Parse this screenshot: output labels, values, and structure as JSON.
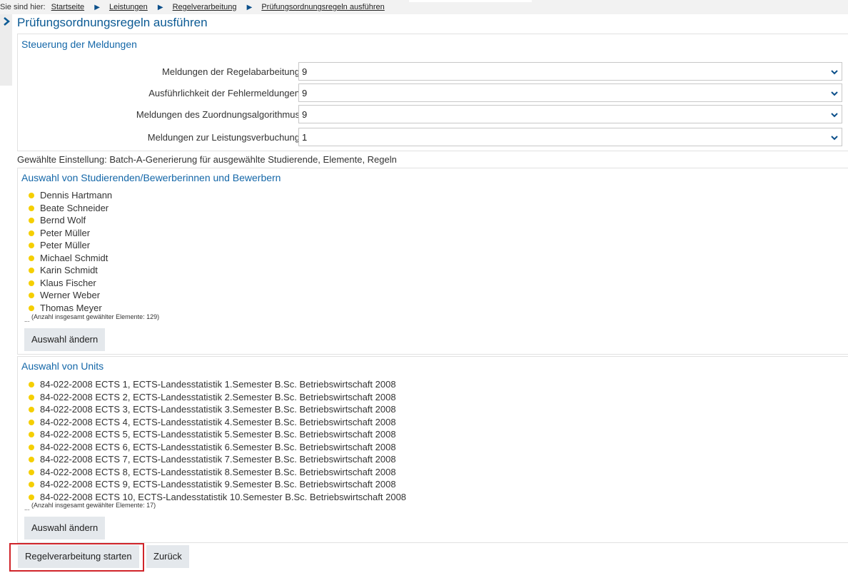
{
  "breadcrumb": {
    "prefix": "Sie sind hier:",
    "items": [
      "Startseite",
      "Leistungen",
      "Regelverarbeitung",
      "Prüfungsordnungsregeln ausführen"
    ]
  },
  "page_title": "Prüfungsordnungsregeln ausführen",
  "steuerung": {
    "title": "Steuerung der Meldungen",
    "rows": [
      {
        "label": "Meldungen der Regelabarbeitung",
        "value": "9"
      },
      {
        "label": "Ausführlichkeit der Fehlermeldungen",
        "value": "9"
      },
      {
        "label": "Meldungen des Zuordnungsalgorithmus",
        "value": "9"
      },
      {
        "label": "Meldungen zur Leistungsverbuchung",
        "value": "1"
      }
    ]
  },
  "selected_setting": "Gewählte Einstellung: Batch-A-Generierung für ausgewählte Studierende, Elemente, Regeln",
  "students": {
    "title": "Auswahl von Studierenden/Bewerberinnen und Bewerbern",
    "items": [
      "Dennis Hartmann",
      "Beate Schneider",
      "Bernd Wolf",
      "Peter Müller",
      "Peter Müller",
      "Michael Schmidt",
      "Karin Schmidt",
      "Klaus Fischer",
      "Werner Weber",
      "Thomas Meyer"
    ],
    "ellipsis": "...",
    "count_note": "(Anzahl insgesamt gewählter Elemente: 129)",
    "change_button": "Auswahl ändern"
  },
  "units": {
    "title": "Auswahl von Units",
    "items": [
      "84-022-2008 ECTS 1, ECTS-Landesstatistik 1.Semester B.Sc. Betriebswirtschaft 2008",
      "84-022-2008 ECTS 2, ECTS-Landesstatistik 2.Semester B.Sc. Betriebswirtschaft 2008",
      "84-022-2008 ECTS 3, ECTS-Landesstatistik 3.Semester B.Sc. Betriebswirtschaft 2008",
      "84-022-2008 ECTS 4, ECTS-Landesstatistik 4.Semester B.Sc. Betriebswirtschaft 2008",
      "84-022-2008 ECTS 5, ECTS-Landesstatistik 5.Semester B.Sc. Betriebswirtschaft 2008",
      "84-022-2008 ECTS 6, ECTS-Landesstatistik 6.Semester B.Sc. Betriebswirtschaft 2008",
      "84-022-2008 ECTS 7, ECTS-Landesstatistik 7.Semester B.Sc. Betriebswirtschaft 2008",
      "84-022-2008 ECTS 8, ECTS-Landesstatistik 8.Semester B.Sc. Betriebswirtschaft 2008",
      "84-022-2008 ECTS 9, ECTS-Landesstatistik 9.Semester B.Sc. Betriebswirtschaft 2008",
      "84-022-2008 ECTS 10, ECTS-Landesstatistik 10.Semester B.Sc. Betriebswirtschaft 2008"
    ],
    "ellipsis": "...",
    "count_note": "(Anzahl insgesamt gewählter Elemente: 17)",
    "change_button": "Auswahl ändern"
  },
  "actions": {
    "start_label": "Regelverarbeitung starten",
    "back_label": "Zurück"
  },
  "colors": {
    "heading": "#0b5a94",
    "bullet": "#f5cf00",
    "button_bg": "#e4e8ec",
    "highlight": "#d0242a"
  }
}
